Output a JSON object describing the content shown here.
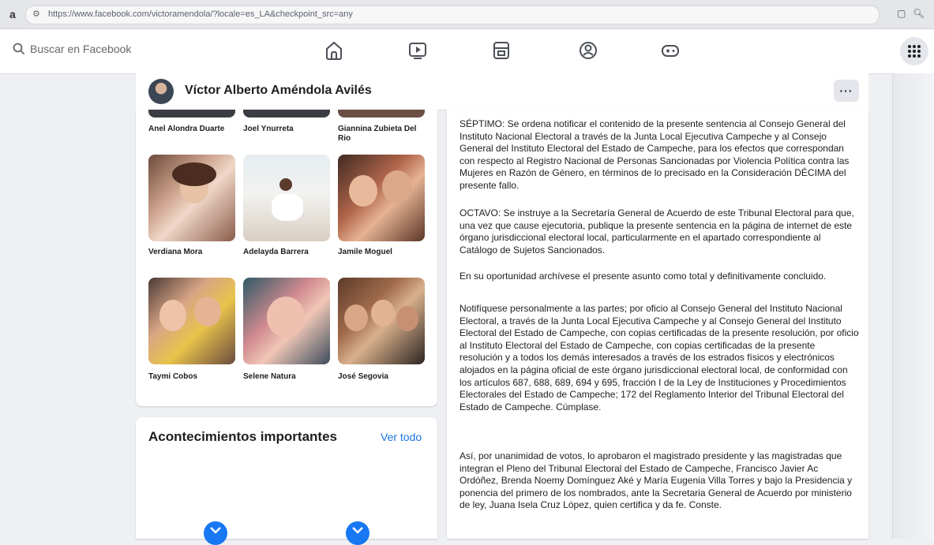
{
  "browser": {
    "url": "https://www.facebook.com/victoramendola/?locale=es_LA&checkpoint_src=any"
  },
  "header": {
    "search_placeholder": "Buscar en Facebook",
    "nav_icons": [
      "home-icon",
      "video-icon",
      "marketplace-icon",
      "groups-icon",
      "gaming-icon"
    ]
  },
  "profile": {
    "name": "Víctor Alberto Améndola Avilés",
    "more_label": "···"
  },
  "friends": {
    "top_row": [
      "Anel Alondra Duarte",
      "Joel Ynurreta",
      "Giannina Zubieta Del Rio"
    ],
    "rows": [
      [
        "Verdiana Mora",
        "Adelayda Barrera",
        "Jamile Moguel"
      ],
      [
        "Taymi Cobos",
        "Selene Natura",
        "José Segovia"
      ]
    ]
  },
  "events": {
    "title": "Acontecimientos importantes",
    "see_all": "Ver todo"
  },
  "post": {
    "paragraphs": [
      "SÉPTIMO: Se ordena notificar el contenido de la presente sentencia al Consejo General del Instituto Nacional Electoral a través de la Junta Local Ejecutiva Campeche y al Consejo General del Instituto Electoral del Estado de Campeche, para los efectos que correspondan con respecto al Registro Nacional de Personas Sancionadas por Violencia Política contra las Mujeres en Razón de Género, en términos de lo precisado en la Consideración DÉCIMA del presente fallo.",
      "OCTAVO: Se instruye a la Secretaría General de Acuerdo de este Tribunal Electoral para que, una vez que cause ejecutoria, publique la presente sentencia en la página de internet de este órgano jurisdiccional electoral local, particularmente en el apartado correspondiente al Catálogo de Sujetos Sancionados.",
      "En su oportunidad archívese el presente asunto como total y definitivamente concluido.",
      "Notifíquese personalmente a las partes; por oficio al Consejo General del Instituto Nacional Electoral, a través de la Junta Local Ejecutiva Campeche y al Consejo General del Instituto Electoral del Estado de Campeche, con copias certificadas de la presente resolución, por oficio al Instituto Electoral del Estado de Campeche, con copias certificadas de la presente resolución y a todos los demás interesados a través de los estrados físicos y electrónicos alojados en la página oficial de este órgano jurisdiccional electoral local, de conformidad con los artículos 687, 688, 689, 694 y 695, fracción I de la Ley de Instituciones y Procedimientos Electorales del Estado de Campeche; 172 del Reglamento Interior del Tribunal Electoral del Estado de Campeche. Cúmplase.",
      "Así, por unanimidad de votos, lo aprobaron el magistrado presidente y las magistradas que integran el Pleno del Tribunal Electoral del Estado de Campeche, Francisco Javier Ac Ordóñez, Brenda Noemy Domínguez Aké y María Eugenia Villa Torres y bajo la Presidencia y ponencia del primero de los nombrados, ante la Secretaria General de Acuerdo por ministerio de ley, Juana Isela Cruz López, quien certifica y da fe. Conste."
    ]
  },
  "colors": {
    "brand_blue": "#1877f2",
    "link_blue": "#1b74e4",
    "page_bg": "#eef0f3"
  }
}
